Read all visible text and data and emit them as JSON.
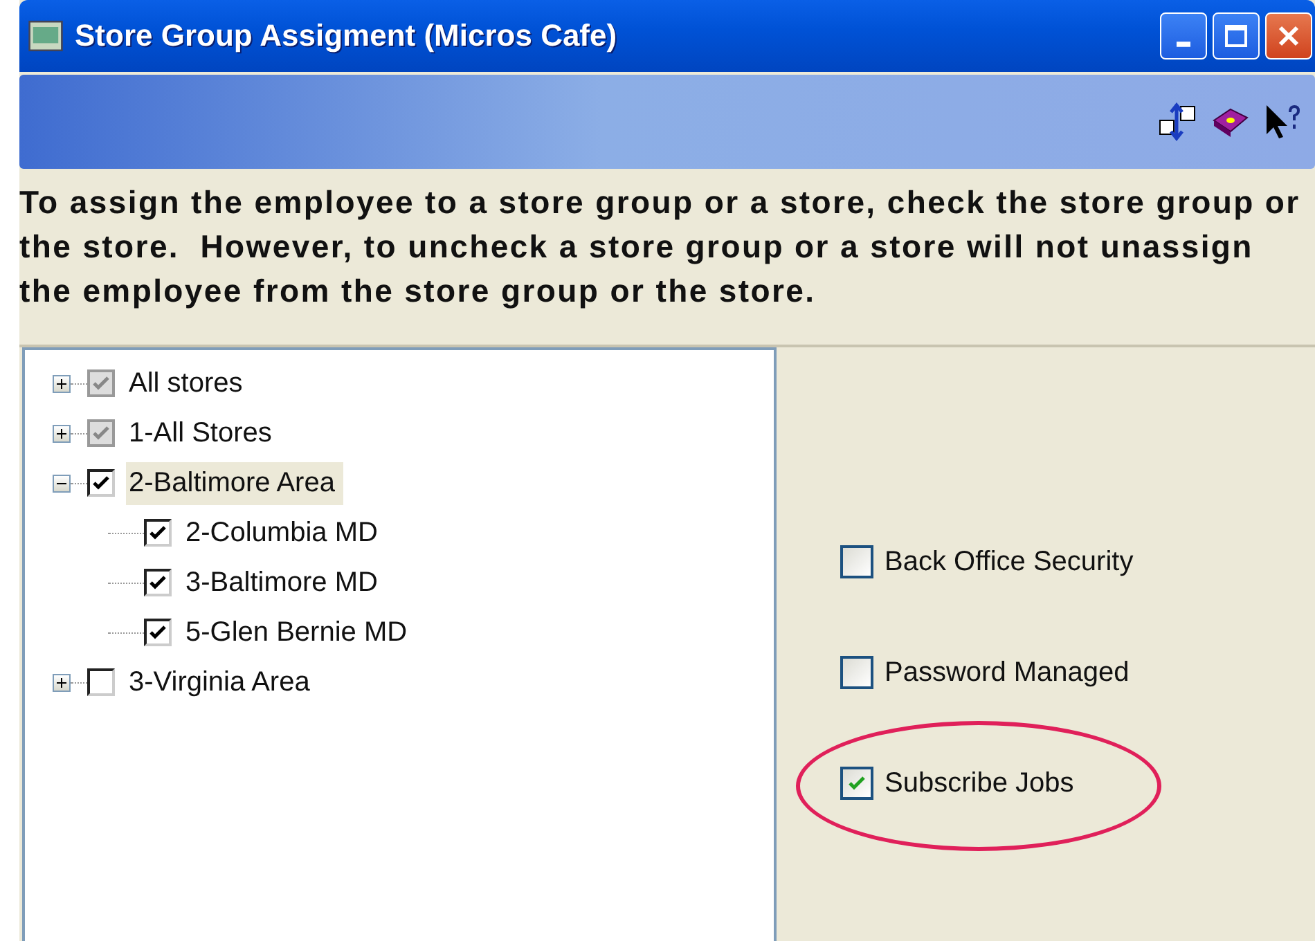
{
  "window": {
    "title": "Store Group Assigment (Micros Cafe)"
  },
  "instructions": "To assign the employee to a store group or a store, check the store group or the store.  However, to uncheck a store group or a store will not unassign the employee from the store group or the store.",
  "tree": [
    {
      "label": "All stores",
      "checked": true,
      "disabled": true,
      "expanded": false,
      "selected": false
    },
    {
      "label": "1-All Stores",
      "checked": true,
      "disabled": true,
      "expanded": false,
      "selected": false
    },
    {
      "label": "2-Baltimore Area",
      "checked": true,
      "disabled": false,
      "expanded": true,
      "selected": true,
      "children": [
        {
          "label": "2-Columbia MD",
          "checked": true,
          "disabled": false,
          "selected": false
        },
        {
          "label": "3-Baltimore MD",
          "checked": true,
          "disabled": false,
          "selected": false
        },
        {
          "label": "5-Glen Bernie MD",
          "checked": true,
          "disabled": false,
          "selected": false
        }
      ]
    },
    {
      "label": "3-Virginia Area",
      "checked": false,
      "disabled": false,
      "expanded": false,
      "selected": false
    }
  ],
  "options": [
    {
      "label": "Back Office Security",
      "checked": false,
      "circled": false
    },
    {
      "label": "Password Managed",
      "checked": false,
      "circled": false
    },
    {
      "label": "Subscribe Jobs",
      "checked": true,
      "circled": true
    }
  ]
}
